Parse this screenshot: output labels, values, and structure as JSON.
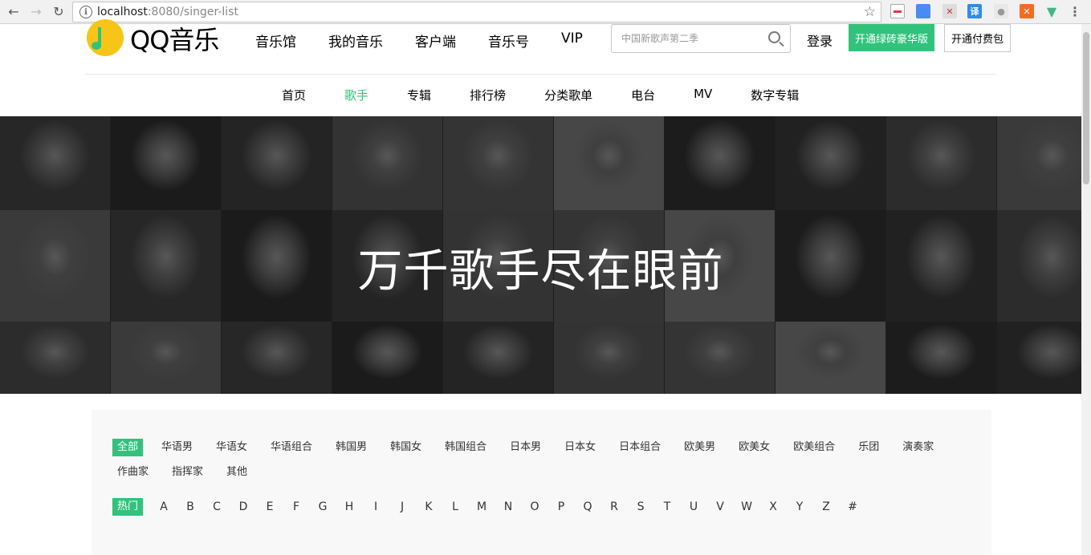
{
  "browser": {
    "url_host": "localhost",
    "url_path": ":8080/singer-list"
  },
  "site": {
    "logo_text": "QQ音乐",
    "top_nav": [
      "音乐馆",
      "我的音乐",
      "客户端",
      "音乐号",
      "VIP"
    ],
    "search_placeholder": "中国新歌声第二季",
    "login": "登录",
    "btn_green": "开通绿砖豪华版",
    "btn_outline": "开通付费包",
    "sub_nav": [
      "首页",
      "歌手",
      "专辑",
      "排行榜",
      "分类歌单",
      "电台",
      "MV",
      "数字专辑"
    ],
    "sub_nav_active": "歌手"
  },
  "banner": {
    "title": "万千歌手尽在眼前"
  },
  "filter": {
    "tags": [
      "全部",
      "华语男",
      "华语女",
      "华语组合",
      "韩国男",
      "韩国女",
      "韩国组合",
      "日本男",
      "日本女",
      "日本组合",
      "欧美男",
      "欧美女",
      "欧美组合",
      "乐团",
      "演奏家",
      "作曲家",
      "指挥家",
      "其他"
    ],
    "active_tag": "全部",
    "letters": [
      "热门",
      "A",
      "B",
      "C",
      "D",
      "E",
      "F",
      "G",
      "H",
      "I",
      "J",
      "K",
      "L",
      "M",
      "N",
      "O",
      "P",
      "Q",
      "R",
      "S",
      "T",
      "U",
      "V",
      "W",
      "X",
      "Y",
      "Z",
      "#"
    ],
    "active_letter": "热门"
  },
  "colors": {
    "accent": "#31c27c",
    "logo_yellow": "#f7c517"
  }
}
